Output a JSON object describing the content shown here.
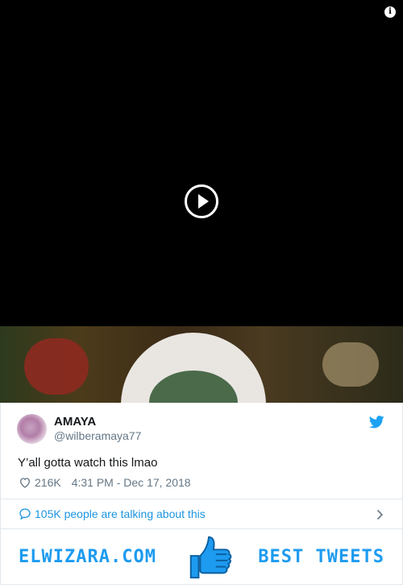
{
  "tweet": {
    "name": "AMAYA",
    "handle": "@wilberamaya77",
    "text": "Y’all gotta watch this lmao",
    "likes": "216K",
    "timestamp": "4:31 PM - Dec 17, 2018"
  },
  "conversation": {
    "label": "105K people are talking about this"
  },
  "banner": {
    "site": "ELWIZARA.COM",
    "tagline": "BEST TWEETS"
  },
  "icons": {
    "info": "info-icon",
    "play": "play-icon",
    "bird": "twitter-bird-icon",
    "heart": "heart-icon",
    "bubble": "speech-bubble-icon",
    "chevron": "chevron-right-icon",
    "thumb": "thumbs-up-icon"
  },
  "colors": {
    "accent": "#1da1f2",
    "text": "#14171a",
    "muted": "#657786",
    "link": "#1b95e0"
  }
}
